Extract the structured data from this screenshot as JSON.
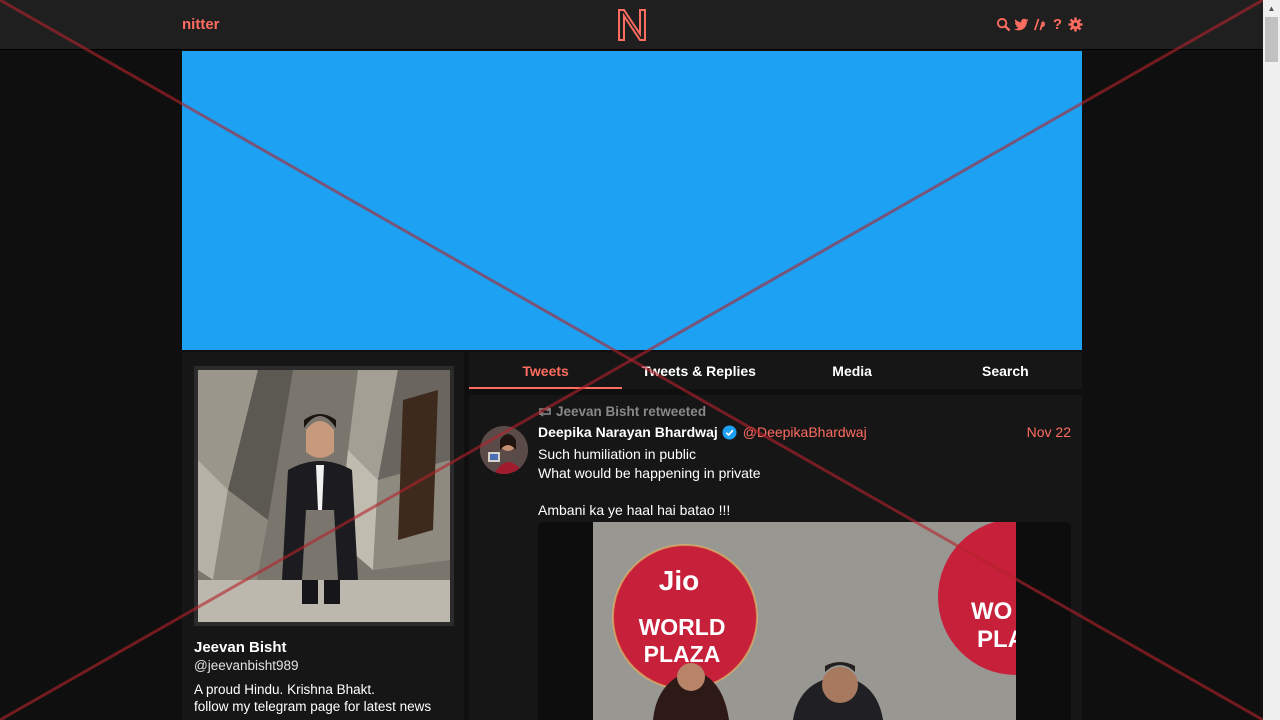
{
  "navbar": {
    "brand": "nitter",
    "logo_letter": "N",
    "icons": [
      "search-icon",
      "twitter-bird-icon",
      "lp-icon",
      "help-icon",
      "settings-gear-icon"
    ]
  },
  "colors": {
    "accent": "#ff6c60",
    "banner": "#1da1f2",
    "background": "#0f0f0f",
    "panel": "#161616"
  },
  "profile": {
    "fullname": "Jeevan Bisht",
    "username": "@jeevanbisht989",
    "bio_line1": "A proud Hindu. Krishna Bhakt.",
    "bio_line2": "follow my telegram page for latest news"
  },
  "tabs": [
    {
      "label": "Tweets",
      "active": true
    },
    {
      "label": "Tweets & Replies",
      "active": false
    },
    {
      "label": "Media",
      "active": false
    },
    {
      "label": "Search",
      "active": false
    }
  ],
  "tweet": {
    "retweet_header": "Jeevan Bisht retweeted",
    "fullname": "Deepika Narayan Bhardwaj",
    "verified": true,
    "username": "@DeepikaBhardwaj",
    "date": "Nov 22",
    "lines": [
      "Such humiliation in public",
      "What would be happening in private",
      "",
      "Ambani ka ye haal hai batao !!!"
    ],
    "media_text": {
      "jio": "Jio",
      "world": "WORLD",
      "plaza": "PLAZA",
      "wo": "WO",
      "pla": "PLA"
    }
  }
}
